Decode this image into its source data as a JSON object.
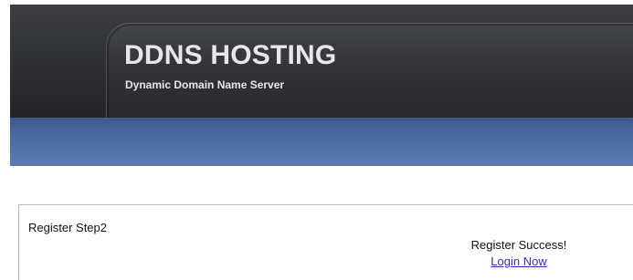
{
  "header": {
    "title": "DDNS HOSTING",
    "subtitle": "Dynamic Domain Name Server"
  },
  "content": {
    "step_title": "Register Step2",
    "success_message": "Register Success!",
    "login_link": "Login Now"
  },
  "colors": {
    "header_dark": "#2f3236",
    "nav_blue": "#4a6ba2",
    "link": "#3b2fb8"
  }
}
